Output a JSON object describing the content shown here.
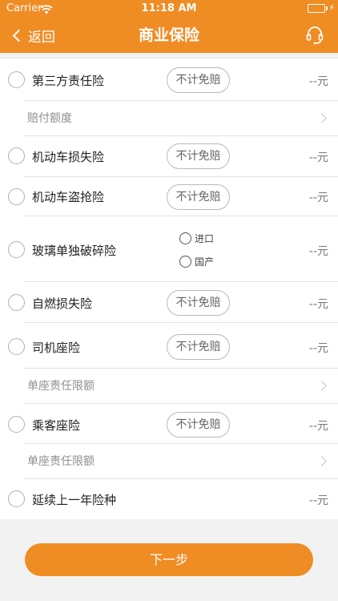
{
  "status_bar": {
    "carrier": "Carrier",
    "time": "11:18 AM",
    "battery_level": 1.0,
    "battery_color": "#4cd964"
  },
  "nav": {
    "back_label": "返回",
    "title": "商业保险",
    "service_icon": "headset-icon"
  },
  "colors": {
    "accent": "#f08c24",
    "footer_bg": "#f2f2f2"
  },
  "insurance_items": [
    {
      "name": "第三方责任险",
      "pill": "不计免赔",
      "price": "--元",
      "sub_label": "赔付额度"
    },
    {
      "name": "机动车损失险",
      "pill": "不计免赔",
      "price": "--元"
    },
    {
      "name": "机动车盗抢险",
      "pill": "不计免赔",
      "price": "--元"
    },
    {
      "name": "玻璃单独破碎险",
      "options": [
        "进口",
        "国产"
      ],
      "price": "--元"
    },
    {
      "name": "自燃损失险",
      "pill": "不计免赔",
      "price": "--元"
    },
    {
      "name": "司机座险",
      "pill": "不计免赔",
      "price": "--元",
      "sub_label": "单座责任限额"
    },
    {
      "name": "乘客座险",
      "pill": "不计免赔",
      "price": "--元",
      "sub_label": "单座责任限额"
    },
    {
      "name": "延续上一年险种",
      "price": "--元"
    }
  ],
  "footer": {
    "next_label": "下一步"
  }
}
